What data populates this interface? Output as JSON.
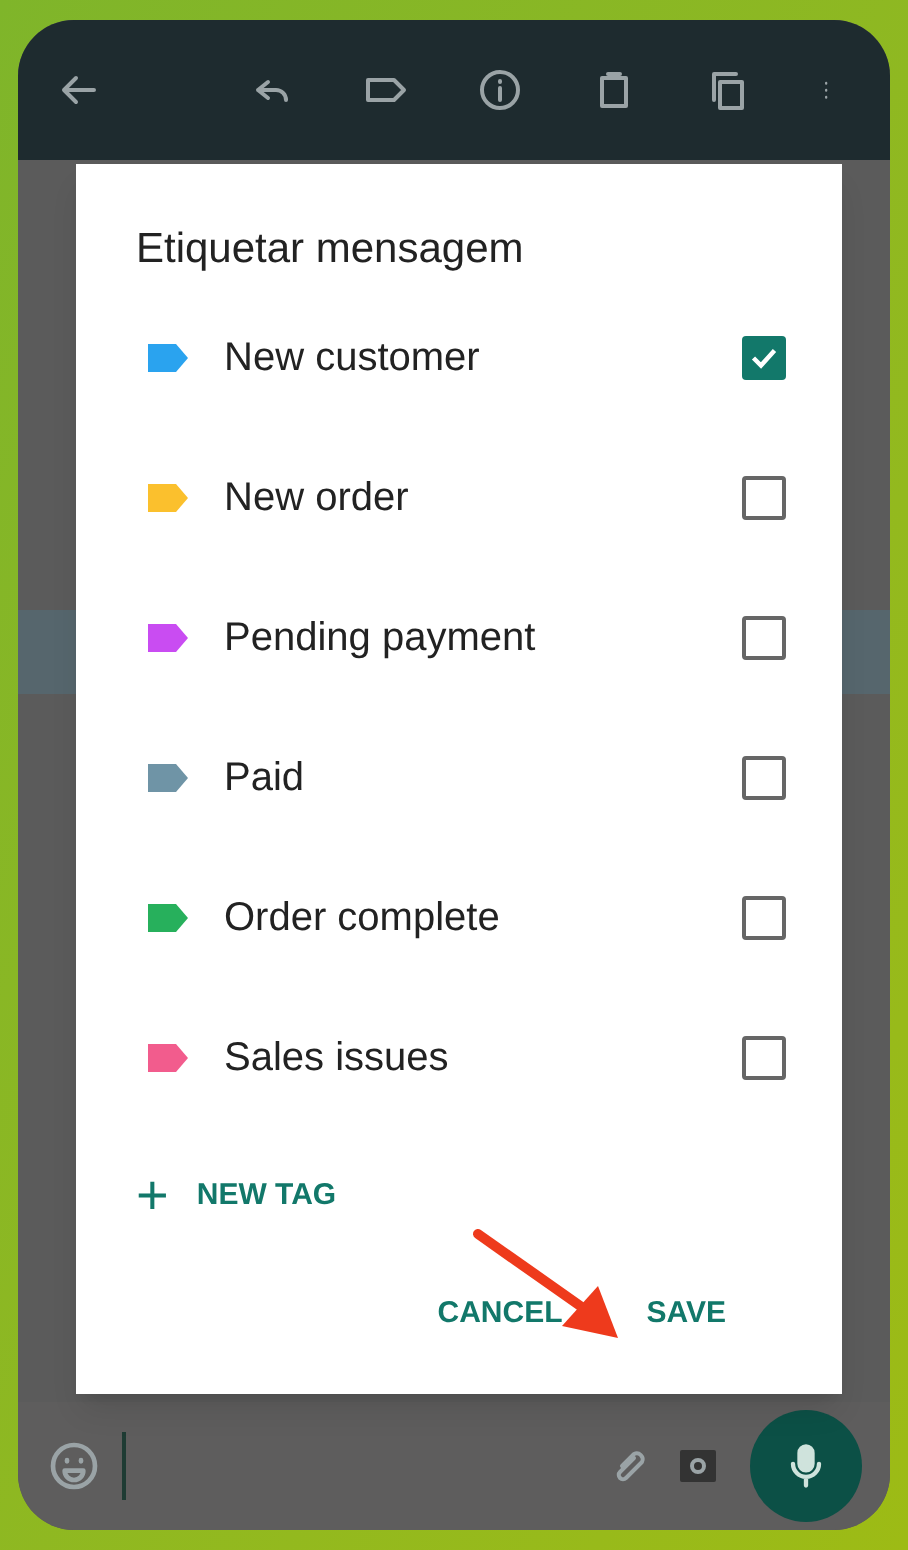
{
  "dialog": {
    "title": "Etiquetar mensagem",
    "tags": [
      {
        "label": "New customer",
        "color": "#2aa3ef",
        "checked": true
      },
      {
        "label": "New order",
        "color": "#fbc02d",
        "checked": false
      },
      {
        "label": "Pending payment",
        "color": "#c94cf2",
        "checked": false
      },
      {
        "label": "Paid",
        "color": "#6f94a6",
        "checked": false
      },
      {
        "label": "Order complete",
        "color": "#27b05c",
        "checked": false
      },
      {
        "label": "Sales issues",
        "color": "#f25c8d",
        "checked": false
      }
    ],
    "new_tag": {
      "icon": "+",
      "label": "NEW TAG"
    },
    "buttons": [
      "CANCEL",
      "SAVE"
    ]
  }
}
